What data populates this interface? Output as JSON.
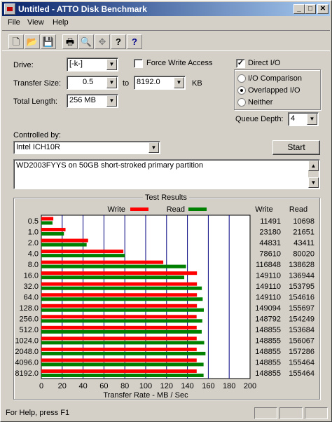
{
  "window": {
    "title": "Untitled - ATTO Disk Benchmark"
  },
  "titlebar_buttons": {
    "minimize": "_",
    "maximize": "□",
    "close": "✕"
  },
  "menu": [
    {
      "label": "File"
    },
    {
      "label": "View"
    },
    {
      "label": "Help"
    }
  ],
  "toolbar": {
    "icons": [
      "new-icon",
      "open-icon",
      "save-icon",
      "print-icon",
      "print-preview-icon",
      "move-icon",
      "help-icon",
      "context-help-icon"
    ],
    "glyphs": [
      "🗋",
      "📂",
      "💾",
      "🖶",
      "🔍",
      "✥",
      "?",
      "?"
    ]
  },
  "form": {
    "drive_label": "Drive:",
    "drive_value": "[-k-]",
    "force_write_label": "Force Write Access",
    "direct_io_label": "Direct I/O",
    "transfer_size_label": "Transfer Size:",
    "transfer_from": "0.5",
    "to_label": "to",
    "transfer_to": "8192.0",
    "kb_label": "KB",
    "total_length_label": "Total Length:",
    "total_length_value": "256 MB",
    "io_comparison_label": "I/O Comparison",
    "overlapped_io_label": "Overlapped I/O",
    "neither_label": "Neither",
    "queue_depth_label": "Queue Depth:",
    "queue_depth_value": "4",
    "controlled_by_label": "Controlled by:",
    "controller_value": "Intel ICH10R",
    "start_label": "Start",
    "description": "WD2003FYYS on 50GB short-stroked primary partition",
    "force_write_checked": false,
    "direct_io_checked": true,
    "selected_mode": "Overlapped I/O"
  },
  "results": {
    "group_title": "Test Results",
    "legend_write": "Write",
    "legend_read": "Read",
    "col_write": "Write",
    "col_read": "Read",
    "xlabel": "Transfer Rate - MB / Sec",
    "rows": [
      {
        "size": "0.5",
        "write": "11491",
        "read": "10698"
      },
      {
        "size": "1.0",
        "write": "23180",
        "read": "21651"
      },
      {
        "size": "2.0",
        "write": "44831",
        "read": "43411"
      },
      {
        "size": "4.0",
        "write": "78610",
        "read": "80020"
      },
      {
        "size": "8.0",
        "write": "116848",
        "read": "138628"
      },
      {
        "size": "16.0",
        "write": "149110",
        "read": "136944"
      },
      {
        "size": "32.0",
        "write": "149110",
        "read": "153795"
      },
      {
        "size": "64.0",
        "write": "149110",
        "read": "154616"
      },
      {
        "size": "128.0",
        "write": "149094",
        "read": "155697"
      },
      {
        "size": "256.0",
        "write": "148792",
        "read": "154249"
      },
      {
        "size": "512.0",
        "write": "148855",
        "read": "153684"
      },
      {
        "size": "1024.0",
        "write": "148855",
        "read": "156067"
      },
      {
        "size": "2048.0",
        "write": "148855",
        "read": "157286"
      },
      {
        "size": "4096.0",
        "write": "148855",
        "read": "155464"
      },
      {
        "size": "8192.0",
        "write": "148855",
        "read": "155464"
      }
    ]
  },
  "chart_data": {
    "type": "bar",
    "categories": [
      "0.5",
      "1.0",
      "2.0",
      "4.0",
      "8.0",
      "16.0",
      "32.0",
      "64.0",
      "128.0",
      "256.0",
      "512.0",
      "1024.0",
      "2048.0",
      "4096.0",
      "8192.0"
    ],
    "series": [
      {
        "name": "Write",
        "values": [
          11.491,
          23.18,
          44.831,
          78.61,
          116.848,
          149.11,
          149.11,
          149.11,
          149.094,
          148.792,
          148.855,
          148.855,
          148.855,
          148.855,
          148.855
        ]
      },
      {
        "name": "Read",
        "values": [
          10.698,
          21.651,
          43.411,
          80.02,
          138.628,
          136.944,
          153.795,
          154.616,
          155.697,
          154.249,
          153.684,
          156.067,
          157.286,
          155.464,
          155.464
        ]
      }
    ],
    "xlabel": "Transfer Rate - MB / Sec",
    "xlim": [
      0,
      200
    ],
    "xticks": [
      "0",
      "20",
      "40",
      "60",
      "80",
      "100",
      "120",
      "140",
      "160",
      "180",
      "200"
    ],
    "orientation": "horizontal",
    "grid": true,
    "colors": {
      "Write": "#ff0000",
      "Read": "#008000"
    },
    "legend": "top"
  },
  "status": {
    "text": "For Help, press F1"
  }
}
